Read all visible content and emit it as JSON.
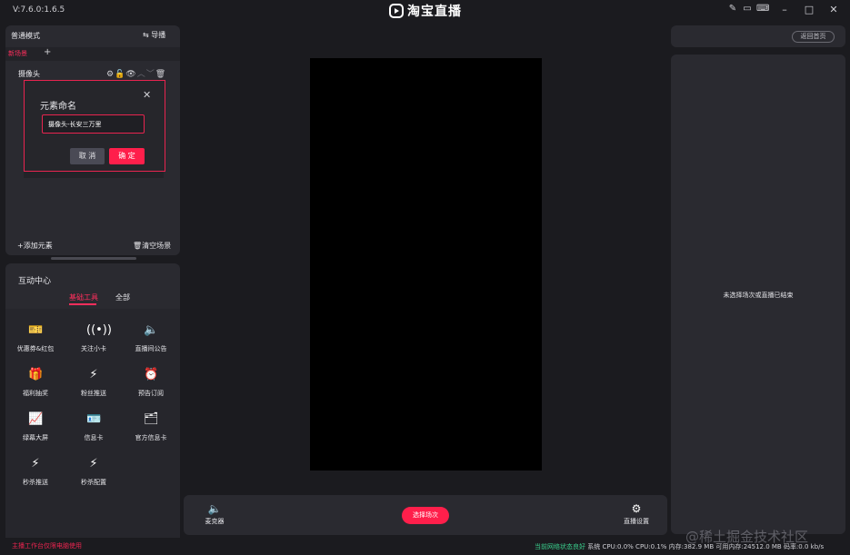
{
  "app": {
    "version": "V:7.6.0:1.6.5",
    "brand": "淘宝直播"
  },
  "scene_panel": {
    "mode_label": "普通模式",
    "guide_label": "⇆ 导播",
    "active_tab": "新场景",
    "add_tab": "+",
    "element_name": "摄像头",
    "add_element": "+添加元素",
    "clear_scene": "🗑清空场景"
  },
  "rename_dialog": {
    "title": "元素命名",
    "input_value": "摄像头-长安三万里",
    "cancel_label": "取 消",
    "ok_label": "确 定"
  },
  "interaction": {
    "title": "互动中心",
    "tabs": [
      "基础工具",
      "全部"
    ],
    "tools": [
      {
        "label": "优惠券&红包",
        "icon": "coupon-icon"
      },
      {
        "label": "关注小卡",
        "icon": "broadcast-icon"
      },
      {
        "label": "直播间公告",
        "icon": "speaker-icon"
      },
      {
        "label": "福利抽奖",
        "icon": "gift-icon"
      },
      {
        "label": "粉丝推送",
        "icon": "bolt-card-icon"
      },
      {
        "label": "预告订阅",
        "icon": "alarm-icon"
      },
      {
        "label": "绿幕大屏",
        "icon": "chart-icon"
      },
      {
        "label": "信息卡",
        "icon": "id-card-icon"
      },
      {
        "label": "官方信息卡",
        "icon": "official-card-icon"
      },
      {
        "label": "秒杀推送",
        "icon": "flash-push-icon"
      },
      {
        "label": "秒杀配置",
        "icon": "flash-config-icon"
      }
    ]
  },
  "bottom_bar": {
    "mic_label": "麦克器",
    "select_scene": "选择场次",
    "live_settings": "直播设置"
  },
  "right_panel": {
    "return_label": "返回首页",
    "message": "未选择场次或直播已结束"
  },
  "footer": {
    "warning": "主播工作台仅限电脑使用",
    "network": "当前网络状态良好",
    "system": "系统 CPU:0.0% CPU:0.1% 内存:382.9 MB 可用内存:24512.0 MB 码率:0.0 kb/s"
  },
  "watermark": "@稀土掘金技术社区",
  "colors": {
    "accent": "#ff1f4b",
    "background": "#1b1b1f",
    "panel": "#2a2a30",
    "network_ok": "#3ad18e"
  }
}
